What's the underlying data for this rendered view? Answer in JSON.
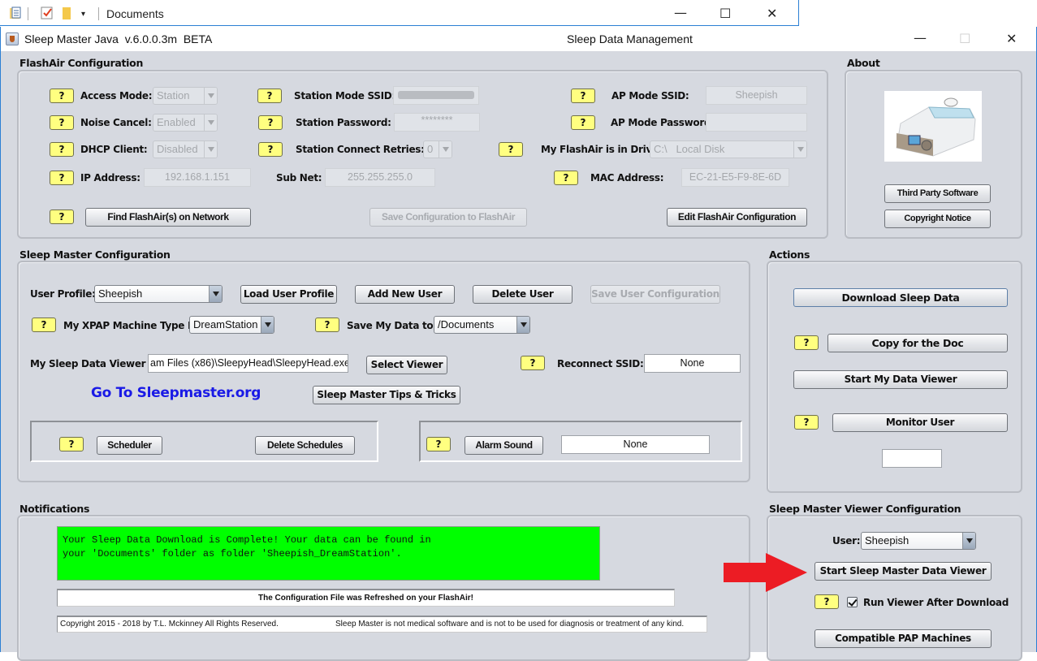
{
  "explorer": {
    "title": "Documents",
    "icons": [
      "properties-icon",
      "checkmark-icon",
      "folder-icon",
      "customize-dropdown-icon"
    ],
    "controls": {
      "minimize": "—",
      "maximize": "☐",
      "close": "✕"
    }
  },
  "window": {
    "app_title": "Sleep Master Java  v.6.0.0.3m  BETA",
    "subtitle": "Sleep Data Management",
    "controls": {
      "minimize": "—",
      "maximize": "☐",
      "close": "✕"
    }
  },
  "flashair": {
    "title": "FlashAir Configuration",
    "help": "?",
    "access_mode": {
      "label": "Access Mode:",
      "value": "Station"
    },
    "noise_cancel": {
      "label": "Noise Cancel:",
      "value": "Enabled"
    },
    "dhcp_client": {
      "label": "DHCP Client:",
      "value": "Disabled"
    },
    "ip_address": {
      "label": "IP Address:",
      "value": "192.168.1.151"
    },
    "station_ssid": {
      "label": "Station Mode SSID:",
      "value": ""
    },
    "station_password": {
      "label": "Station Password:",
      "value": "********"
    },
    "station_retries": {
      "label": "Station Connect Retries:",
      "value": "0"
    },
    "subnet": {
      "label": "Sub Net:",
      "value": "255.255.255.0"
    },
    "ap_ssid": {
      "label": "AP Mode SSID:",
      "value": "Sheepish"
    },
    "ap_password": {
      "label": "AP Mode Password:",
      "value": ""
    },
    "drive": {
      "label": "My FlashAir is in Drive:",
      "value": "C:\\   Local Disk"
    },
    "mac": {
      "label": "MAC Address:",
      "value": "EC-21-E5-F9-8E-6D"
    },
    "find_button": "Find FlashAir(s) on Network",
    "save_button": "Save Configuration to FlashAir",
    "edit_button": "Edit FlashAir Configuration"
  },
  "about": {
    "title": "About",
    "third_party_button": "Third Party Software",
    "copyright_button": "Copyright Notice"
  },
  "sleepmaster": {
    "title": "Sleep Master Configuration",
    "user_profile": {
      "label": "User Profile:",
      "value": "Sheepish"
    },
    "load_button": "Load User Profile",
    "add_button": "Add New User",
    "delete_button": "Delete User",
    "save_button": "Save User Configuration",
    "machine": {
      "label": "My XPAP Machine Type Is:",
      "value": "DreamStation"
    },
    "save_to": {
      "label": "Save My Data to :",
      "value": "/Documents"
    },
    "viewer": {
      "label": "My Sleep Data Viewer is:",
      "value": "am Files (x86)\\SleepyHead\\SleepyHead.exe"
    },
    "select_viewer_button": "Select Viewer",
    "reconnect": {
      "label": "Reconnect SSID:",
      "value": "None"
    },
    "website_link": "Go To Sleepmaster.org",
    "tips_button": "Sleep Master Tips & Tricks",
    "scheduler_button": "Scheduler",
    "delete_schedules_button": "Delete Schedules",
    "alarm_button": "Alarm Sound",
    "alarm_value": "None"
  },
  "actions": {
    "title": "Actions",
    "download_button": "Download Sleep Data",
    "copy_doc_button": "Copy for the Doc",
    "start_viewer_button": "Start My Data Viewer",
    "monitor_button": "Monitor User",
    "monitor_value": ""
  },
  "notifications": {
    "title": "Notifications",
    "message": "Your Sleep Data Download is Complete! Your data can be found in\nyour 'Documents' folder as folder 'Sheepish_DreamStation'.",
    "message_color": "#00ff00",
    "status": "The Configuration File was Refreshed on your FlashAir!",
    "copyright": "Copyright 2015 - 2018 by T.L. Mckinney   All Rights Reserved.",
    "disclaimer": "Sleep Master is not medical software and is not to be used for diagnosis or treatment of any kind."
  },
  "viewer_config": {
    "title": "Sleep Master Viewer Configuration",
    "user": {
      "label": "User:",
      "value": "Sheepish"
    },
    "start_button": "Start Sleep Master Data Viewer",
    "run_after": {
      "label": "Run Viewer After Download",
      "checked": true
    },
    "compatible_button": "Compatible PAP Machines"
  },
  "annotation": {
    "arrow_color": "#ec1c24"
  }
}
